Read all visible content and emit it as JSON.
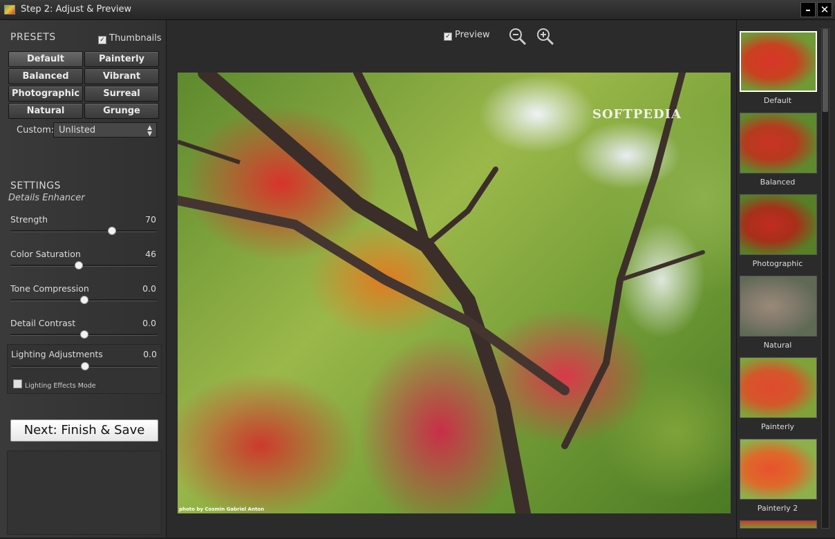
{
  "window": {
    "title": "Step 2: Adjust & Preview",
    "minimize_label": "–",
    "close_label": "✕"
  },
  "presets": {
    "title": "PRESETS",
    "thumbnails_label": "Thumbnails",
    "buttons": [
      "Default",
      "Painterly",
      "Balanced",
      "Vibrant",
      "Photographic",
      "Surreal",
      "Natural",
      "Grunge"
    ],
    "custom_label": "Custom:",
    "custom_value": "Unlisted"
  },
  "settings": {
    "title": "SETTINGS",
    "subtitle": "Details Enhancer",
    "sliders": [
      {
        "label": "Strength",
        "value": "70",
        "position": 0.69
      },
      {
        "label": "Color Saturation",
        "value": "46",
        "position": 0.46
      },
      {
        "label": "Tone Compression",
        "value": "0.0",
        "position": 0.5
      },
      {
        "label": "Detail Contrast",
        "value": "0.0",
        "position": 0.5
      },
      {
        "label": "Lighting Adjustments",
        "value": "0.0",
        "position": 0.5
      }
    ],
    "lighting_mode_label": "Lighting Effects Mode",
    "next_label": "Next: Finish & Save"
  },
  "preview": {
    "preview_label": "Preview",
    "zoom_out_icon": "zoom-out-icon",
    "zoom_in_icon": "zoom-in-icon",
    "watermark": "SOFTPEDIA",
    "credit": "photo by Cosmin Gabriel Anton"
  },
  "thumbnails": [
    {
      "label": "Default",
      "selected": true
    },
    {
      "label": "Balanced",
      "selected": false
    },
    {
      "label": "Photographic",
      "selected": false
    },
    {
      "label": "Natural",
      "selected": false
    },
    {
      "label": "Painterly",
      "selected": false
    },
    {
      "label": "Painterly 2",
      "selected": false
    }
  ]
}
